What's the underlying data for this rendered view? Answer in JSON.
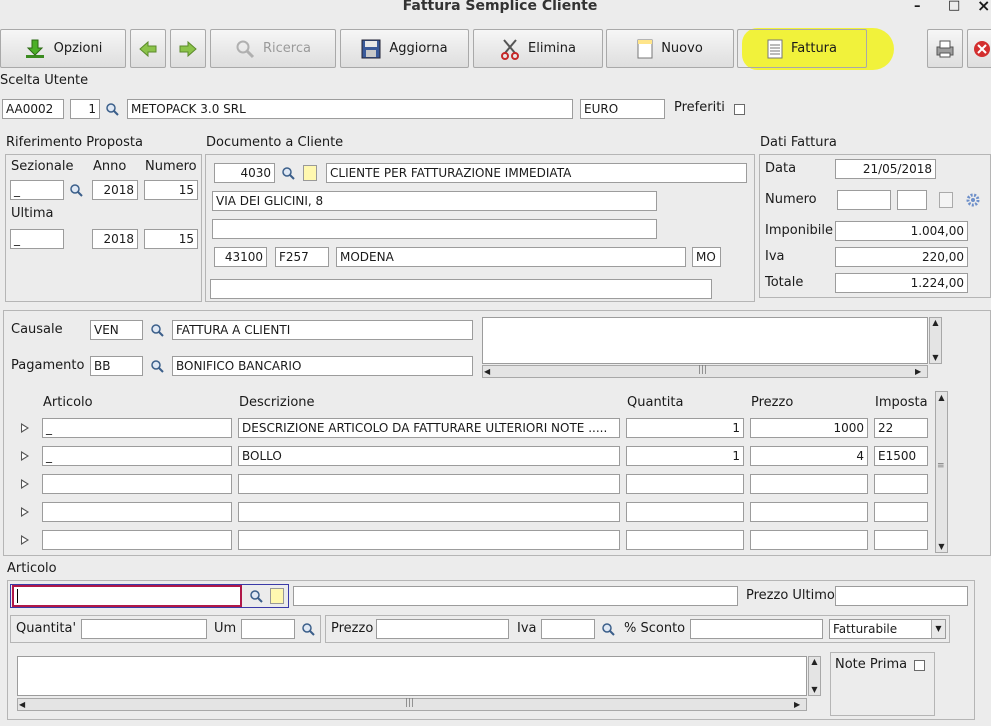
{
  "window": {
    "title": "Fattura Semplice Cliente",
    "min": "–",
    "max": "□",
    "close": "×"
  },
  "toolbar": {
    "opzioni": "Opzioni",
    "ricerca": "Ricerca",
    "aggiorna": "Aggiorna",
    "elimina": "Elimina",
    "nuovo": "Nuovo",
    "fattura": "Fattura",
    "highlight_color": "#f3f400"
  },
  "utente": {
    "section": "Scelta Utente",
    "codice": "AA0002",
    "num": "1",
    "nome": "METOPACK 3.0 SRL",
    "valuta": "EURO",
    "preferiti": "Preferiti"
  },
  "proposta": {
    "section": "Riferimento Proposta",
    "sezionale_label": "Sezionale",
    "anno_label": "Anno",
    "numero_label": "Numero",
    "sezionale": "_",
    "anno": "2018",
    "numero": "15",
    "ultima_label": "Ultima",
    "ultima_sez": "_",
    "ultima_anno": "2018",
    "ultima_num": "15"
  },
  "documento": {
    "section": "Documento a Cliente",
    "codice": "4030",
    "ragione": "CLIENTE PER FATTURAZIONE IMMEDIATA",
    "indirizzo": "VIA DEI GLICINI, 8",
    "indirizzo2": "",
    "cap": "43100",
    "istat": "F257",
    "citta": "MODENA",
    "prov": "MO",
    "extra": ""
  },
  "fattura": {
    "section": "Dati Fattura",
    "data_label": "Data",
    "data": "21/05/2018",
    "numero_label": "Numero",
    "num1": "",
    "num2": "",
    "imponibile_label": "Imponibile",
    "imponibile": "1.004,00",
    "iva_label": "Iva",
    "iva": "220,00",
    "totale_label": "Totale",
    "totale": "1.224,00"
  },
  "causale": {
    "label": "Causale",
    "codice": "VEN",
    "descr": "FATTURA A CLIENTI"
  },
  "pagamento": {
    "label": "Pagamento",
    "codice": "BB",
    "descr": "BONIFICO BANCARIO"
  },
  "righe": {
    "headers": {
      "articolo": "Articolo",
      "descrizione": "Descrizione",
      "quantita": "Quantita",
      "prezzo": "Prezzo",
      "imposta": "Imposta"
    },
    "rows": [
      {
        "articolo": "_",
        "descrizione": "DESCRIZIONE ARTICOLO DA FATTURARE ULTERIORI NOTE .....",
        "quantita": "1",
        "prezzo": "1000",
        "imposta": "22"
      },
      {
        "articolo": "_",
        "descrizione": "BOLLO",
        "quantita": "1",
        "prezzo": "4",
        "imposta": "E1500"
      },
      {
        "articolo": "",
        "descrizione": "",
        "quantita": "",
        "prezzo": "",
        "imposta": ""
      },
      {
        "articolo": "",
        "descrizione": "",
        "quantita": "",
        "prezzo": "",
        "imposta": ""
      },
      {
        "articolo": "",
        "descrizione": "",
        "quantita": "",
        "prezzo": "",
        "imposta": ""
      }
    ]
  },
  "articolo": {
    "section": "Articolo",
    "codice": "",
    "descr": "",
    "prezzo_ultimo_label": "Prezzo Ultimo",
    "prezzo_ultimo": "",
    "quantita_label": "Quantita'",
    "quantita": "",
    "um_label": "Um",
    "um": "",
    "prezzo_label": "Prezzo",
    "prezzo": "",
    "iva_label": "Iva",
    "iva": "",
    "sconto_label": "% Sconto",
    "sconto": "",
    "fatturabile": "Fatturabile",
    "note_prima": "Note Prima"
  }
}
